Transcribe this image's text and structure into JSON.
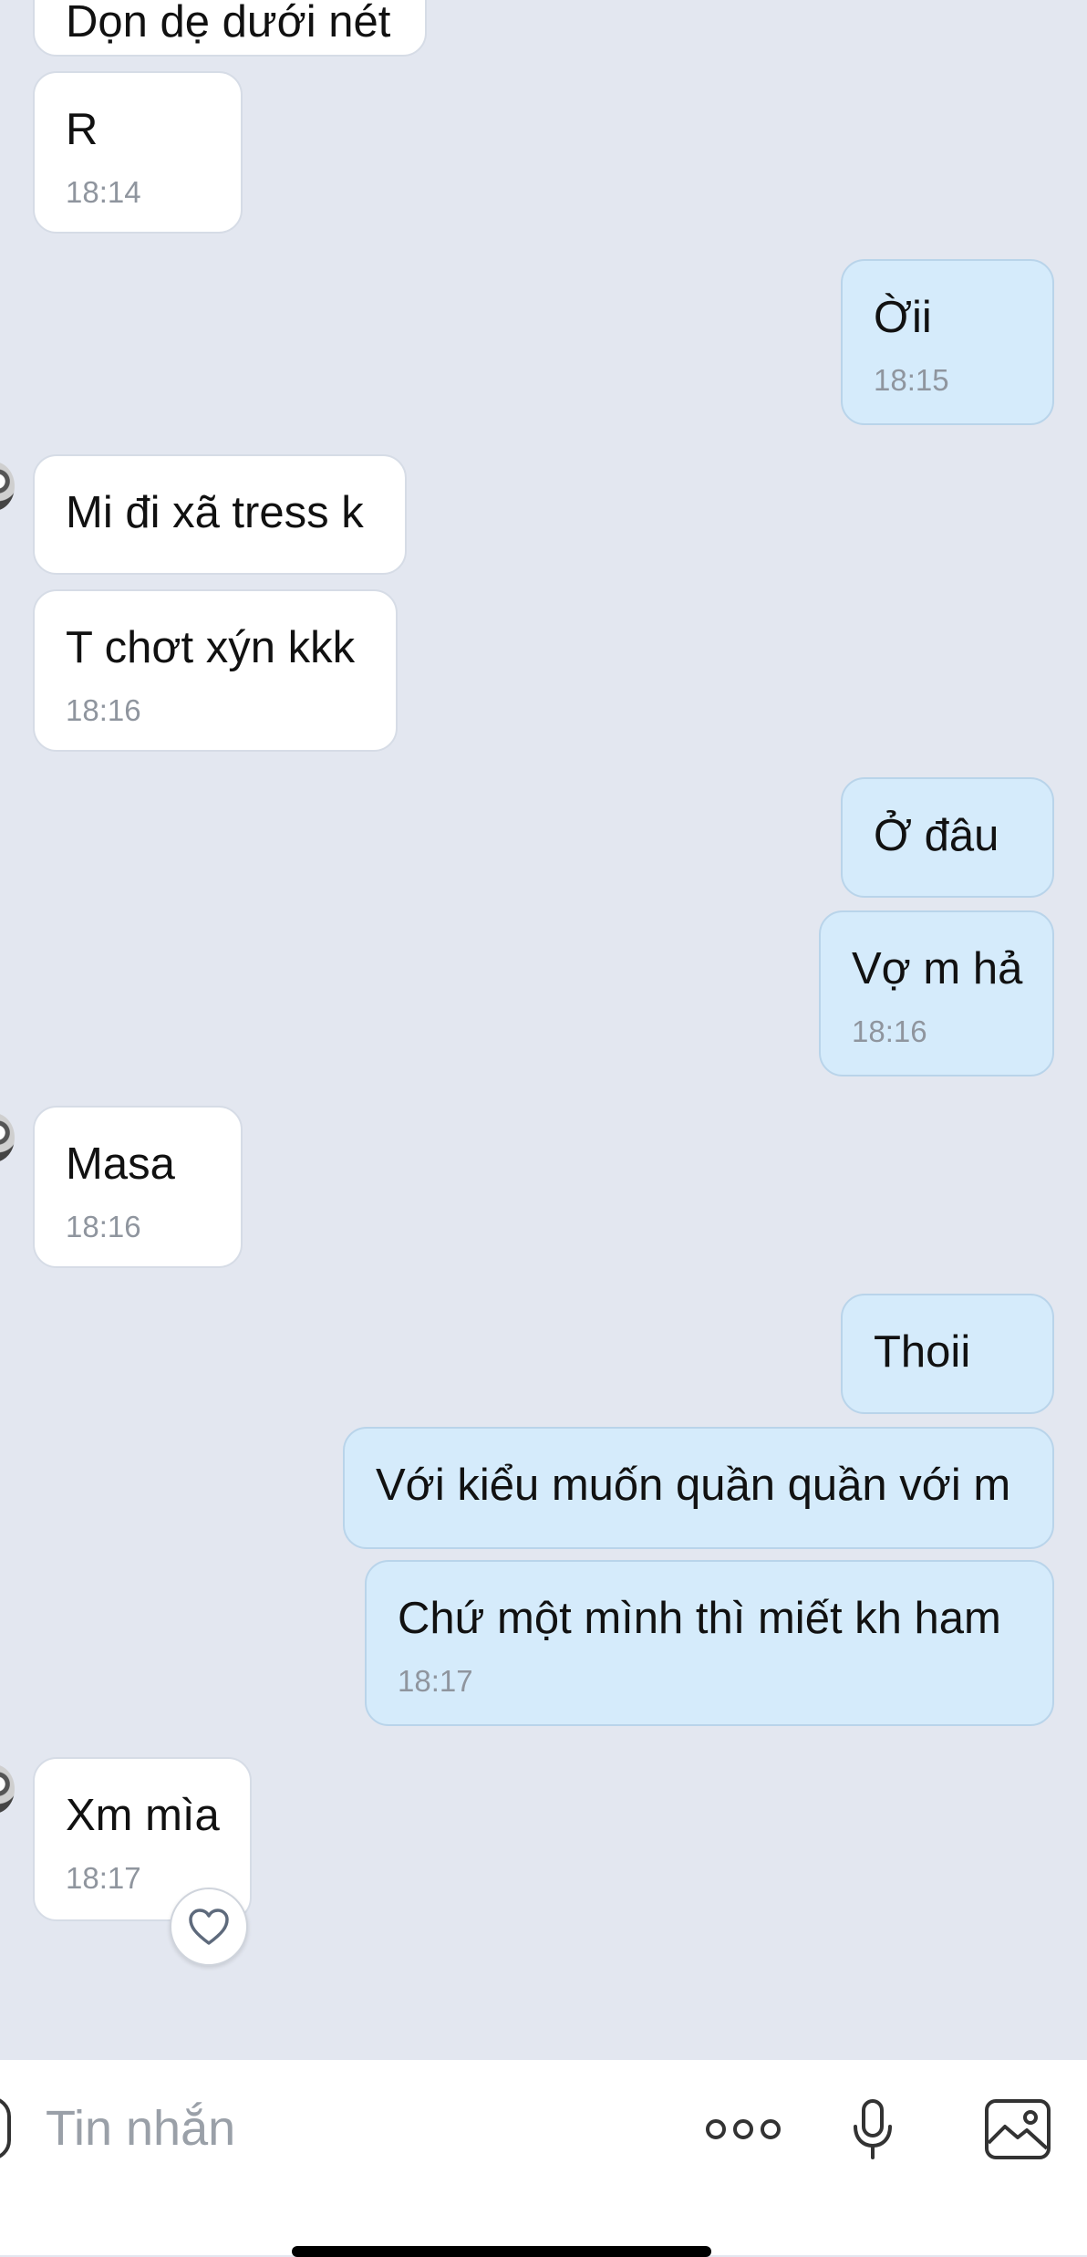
{
  "messages": [
    {
      "side": "in",
      "text": "Dọn dẹ dưới nét",
      "time": ""
    },
    {
      "side": "in",
      "text": "R",
      "time": "18:14"
    },
    {
      "side": "out",
      "text": "Ờii",
      "time": "18:15"
    },
    {
      "side": "in",
      "text": "Mi đi xã tress k",
      "time": ""
    },
    {
      "side": "in",
      "text": "T chơt xýn kkk",
      "time": "18:16"
    },
    {
      "side": "out",
      "text": "Ở đâu",
      "time": ""
    },
    {
      "side": "out",
      "text": "Vợ m hả",
      "time": "18:16"
    },
    {
      "side": "in",
      "text": "Masa",
      "time": "18:16"
    },
    {
      "side": "out",
      "text": "Thoii",
      "time": ""
    },
    {
      "side": "out",
      "text": "Với kiểu muốn quần quần với m",
      "time": ""
    },
    {
      "side": "out",
      "text": "Chứ một mình thì miết kh ham",
      "time": "18:17"
    },
    {
      "side": "in",
      "text": "Xm mìa",
      "time": "18:17"
    }
  ],
  "composer": {
    "placeholder": "Tin nhắn",
    "icons": [
      "sticker-icon",
      "more-icon",
      "microphone-icon",
      "image-icon"
    ]
  },
  "reaction": {
    "icon": "heart-icon"
  }
}
